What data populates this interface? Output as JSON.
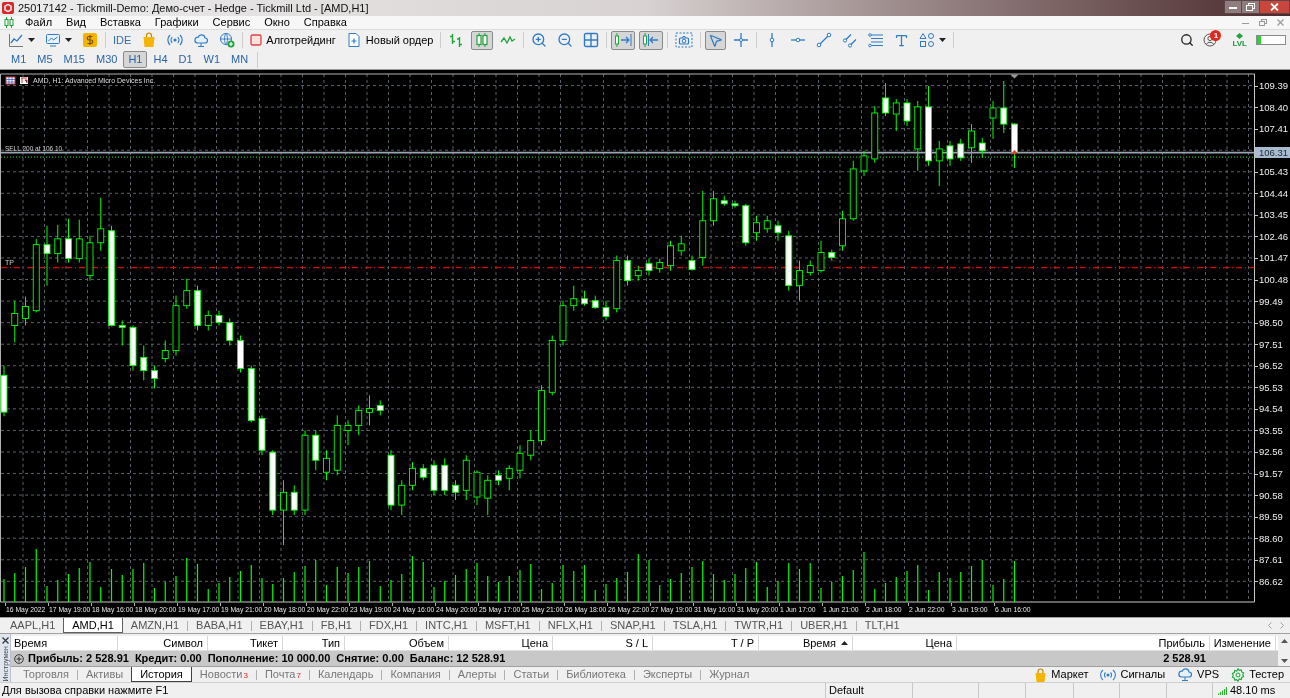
{
  "window": {
    "title": "25017142 - Tickmill-Demo: Демо-счет - Hedge - Tickmill Ltd - [AMD,H1]"
  },
  "menu": [
    "Файл",
    "Вид",
    "Вставка",
    "Графики",
    "Сервис",
    "Окно",
    "Справка"
  ],
  "toolbar": {
    "groups": [
      [
        {
          "selected": false
        },
        {
          "selected": false
        },
        {
          "selected": false
        }
      ],
      [
        {
          "label": "IDE",
          "selected": false
        },
        {
          "selected": false
        },
        {
          "selected": false
        },
        {
          "selected": false
        },
        {
          "selected": false
        }
      ],
      [
        {
          "label": "Алготрейдинг",
          "selected": false,
          "on": false
        },
        {
          "label": "Новый ордер",
          "selected": false
        }
      ],
      [
        {
          "selected": false
        },
        {
          "selected": true
        },
        {
          "selected": false
        }
      ],
      [
        {
          "selected": false
        },
        {
          "selected": false
        },
        {
          "selected": false
        }
      ],
      [
        {
          "selected": true
        },
        {
          "selected": true
        }
      ],
      [
        {
          "selected": false
        }
      ],
      [
        {
          "selected": true
        },
        {
          "selected": false
        }
      ],
      [
        {
          "selected": false
        },
        {
          "selected": false
        },
        {
          "selected": false
        },
        {
          "selected": false
        },
        {
          "selected": false
        },
        {
          "selected": false
        },
        {
          "selected": false
        }
      ]
    ]
  },
  "toolbar_right": {
    "notifications": "1",
    "level_label": "LVL",
    "progress": {
      "level": 0.15
    }
  },
  "timeframes": [
    {
      "label": "M1",
      "selected": false
    },
    {
      "label": "M5",
      "selected": false
    },
    {
      "label": "M15",
      "selected": false
    },
    {
      "label": "M30",
      "selected": false
    },
    {
      "label": "H1",
      "selected": true
    },
    {
      "label": "H4",
      "selected": false
    },
    {
      "label": "D1",
      "selected": false
    },
    {
      "label": "W1",
      "selected": false
    },
    {
      "label": "MN",
      "selected": false
    }
  ],
  "chart": {
    "title": "AMD, H1: Advanced Micro Devices Inc.",
    "chart_data": [
      {
        "type": "candlestick",
        "color": "#00ff00",
        "grid": true,
        "ylim": [
          85.67,
          109.92
        ],
        "yticks": [
          {
            "value": 86.62,
            "label": "86.62"
          },
          {
            "value": 87.61,
            "label": "87.61"
          },
          {
            "value": 88.6,
            "label": "88.60"
          },
          {
            "value": 89.59,
            "label": "89.59"
          },
          {
            "value": 90.58,
            "label": "90.58"
          },
          {
            "value": 91.57,
            "label": "91.57"
          },
          {
            "value": 92.56,
            "label": "92.56"
          },
          {
            "value": 93.55,
            "label": "93.55"
          },
          {
            "value": 94.54,
            "label": "94.54"
          },
          {
            "value": 95.53,
            "label": "95.53"
          },
          {
            "value": 96.52,
            "label": "96.52"
          },
          {
            "value": 97.51,
            "label": "97.51"
          },
          {
            "value": 98.5,
            "label": "98.50"
          },
          {
            "value": 99.49,
            "label": "99.49"
          },
          {
            "value": 100.48,
            "label": "100.48"
          },
          {
            "value": 101.47,
            "label": "101.47"
          },
          {
            "value": 102.46,
            "label": "102.46"
          },
          {
            "value": 103.45,
            "label": "103.45"
          },
          {
            "value": 104.44,
            "label": "104.44"
          },
          {
            "value": 105.43,
            "label": "105.43"
          },
          {
            "value": 107.41,
            "label": "107.41"
          },
          {
            "value": 108.4,
            "label": "108.40"
          },
          {
            "value": 109.39,
            "label": "109.39"
          }
        ],
        "categories": [
          null,
          null,
          "16 May 2022",
          null,
          null,
          null,
          "17 May 19:00",
          null,
          null,
          null,
          "18 May 16:00",
          null,
          null,
          null,
          "18 May 20:00",
          null,
          null,
          null,
          "19 May 17:00",
          null,
          null,
          null,
          "19 May 21:00",
          null,
          null,
          null,
          "20 May 18:00",
          null,
          null,
          null,
          "20 May 22:00",
          null,
          null,
          null,
          "23 May 19:00",
          null,
          null,
          null,
          "24 May 16:00",
          null,
          null,
          null,
          "24 May 20:00",
          null,
          null,
          null,
          "25 May 17:00",
          null,
          null,
          null,
          "25 May 21:00",
          null,
          null,
          null,
          "26 May 18:00",
          null,
          null,
          null,
          "26 May 22:00",
          null,
          null,
          null,
          "27 May 19:00",
          null,
          null,
          null,
          "31 May 16:00",
          null,
          null,
          null,
          "31 May 20:00",
          null,
          null,
          null,
          "1 Jun 17:00",
          null,
          null,
          null,
          "1 Jun 21:00",
          null,
          null,
          null,
          "2 Jun 18:00",
          null,
          null,
          null,
          "2 Jun 22:00",
          null,
          null,
          null,
          "3 Jun 19:00",
          null,
          null,
          null,
          "6 Jun 16:00",
          null,
          null,
          null,
          null,
          null,
          null,
          null,
          null,
          null,
          null,
          null,
          null,
          null,
          null,
          null,
          null,
          null,
          null,
          null,
          null,
          null,
          null
        ],
        "ohlc": [
          [
            96.08,
            96.53,
            94.2,
            94.39
          ],
          [
            98.37,
            99.51,
            97.59,
            98.92
          ],
          [
            98.69,
            99.7,
            98.37,
            99.24
          ],
          [
            99.05,
            102.35,
            98.97,
            102.08
          ],
          [
            102.08,
            102.95,
            100.2,
            101.67
          ],
          [
            101.67,
            102.99,
            101.26,
            102.35
          ],
          [
            102.35,
            103.27,
            101.26,
            101.44
          ],
          [
            101.44,
            103.23,
            101.26,
            102.35
          ],
          [
            100.66,
            102.49,
            100.43,
            102.17
          ],
          [
            102.17,
            104.24,
            101.8,
            102.81
          ],
          [
            102.72,
            102.95,
            98.33,
            98.37
          ],
          [
            98.37,
            98.6,
            97.45,
            98.28
          ],
          [
            98.28,
            98.37,
            96.3,
            96.53
          ],
          [
            96.9,
            97.45,
            95.85,
            96.3
          ],
          [
            96.3,
            96.53,
            95.48,
            95.94
          ],
          [
            96.85,
            97.68,
            96.67,
            97.22
          ],
          [
            97.22,
            99.74,
            96.99,
            99.28
          ],
          [
            99.28,
            100.52,
            99.14,
            99.97
          ],
          [
            99.97,
            100.2,
            98.14,
            98.37
          ],
          [
            98.37,
            99.05,
            98.14,
            98.83
          ],
          [
            98.83,
            99.05,
            98.37,
            98.51
          ],
          [
            98.51,
            98.69,
            97.45,
            97.68
          ],
          [
            97.68,
            97.91,
            96.21,
            96.39
          ],
          [
            96.39,
            96.53,
            93.92,
            94.01
          ],
          [
            94.1,
            94.24,
            92.41,
            92.64
          ],
          [
            92.55,
            92.64,
            89.66,
            89.89
          ],
          [
            89.89,
            91.26,
            88.28,
            90.71
          ],
          [
            90.71,
            91.03,
            89.66,
            89.89
          ],
          [
            89.89,
            93.55,
            89.66,
            93.33
          ],
          [
            93.33,
            93.55,
            91.72,
            92.18
          ],
          [
            91.63,
            92.64,
            91.26,
            92.27
          ],
          [
            91.72,
            94.24,
            91.49,
            93.78
          ],
          [
            93.55,
            94.01,
            92.87,
            93.78
          ],
          [
            93.78,
            94.7,
            93.33,
            94.47
          ],
          [
            94.38,
            95.16,
            93.78,
            94.56
          ],
          [
            94.7,
            94.93,
            94.24,
            94.47
          ],
          [
            92.41,
            92.64,
            89.89,
            90.12
          ],
          [
            90.12,
            91.26,
            89.66,
            91.03
          ],
          [
            91.03,
            92.09,
            90.8,
            91.81
          ],
          [
            91.81,
            92.0,
            91.26,
            91.4
          ],
          [
            91.95,
            92.18,
            90.58,
            90.8
          ],
          [
            91.95,
            92.27,
            90.58,
            90.8
          ],
          [
            91.03,
            91.26,
            90.35,
            90.71
          ],
          [
            90.8,
            92.41,
            90.35,
            92.18
          ],
          [
            90.49,
            91.72,
            90.12,
            91.63
          ],
          [
            90.44,
            91.49,
            89.66,
            91.26
          ],
          [
            91.49,
            91.72,
            91.03,
            91.26
          ],
          [
            91.35,
            91.95,
            90.8,
            91.81
          ],
          [
            91.72,
            92.87,
            91.35,
            92.5
          ],
          [
            92.41,
            93.55,
            92.18,
            93.09
          ],
          [
            93.09,
            95.62,
            92.87,
            95.39
          ],
          [
            95.3,
            97.91,
            95.16,
            97.68
          ],
          [
            97.68,
            99.51,
            97.45,
            99.28
          ],
          [
            99.28,
            100.2,
            99.05,
            99.6
          ],
          [
            99.6,
            99.97,
            99.28,
            99.37
          ],
          [
            99.51,
            99.74,
            99.14,
            99.19
          ],
          [
            99.19,
            99.51,
            98.6,
            98.78
          ],
          [
            99.14,
            101.58,
            98.97,
            101.35
          ],
          [
            101.35,
            101.58,
            100.2,
            100.43
          ],
          [
            100.66,
            101.12,
            100.43,
            100.89
          ],
          [
            101.21,
            101.44,
            100.66,
            100.89
          ],
          [
            100.98,
            101.44,
            100.8,
            101.26
          ],
          [
            101.12,
            102.26,
            100.89,
            102.03
          ],
          [
            101.8,
            102.49,
            101.58,
            102.12
          ],
          [
            101.35,
            101.58,
            100.89,
            100.94
          ],
          [
            101.49,
            104.55,
            101.12,
            103.18
          ],
          [
            103.18,
            104.55,
            102.95,
            104.19
          ],
          [
            104.1,
            104.33,
            103.87,
            103.96
          ],
          [
            103.96,
            104.1,
            103.78,
            103.87
          ],
          [
            103.87,
            103.96,
            102.03,
            102.17
          ],
          [
            102.63,
            103.41,
            102.26,
            103.09
          ],
          [
            102.81,
            103.41,
            102.63,
            103.18
          ],
          [
            102.95,
            103.18,
            102.26,
            102.63
          ],
          [
            102.49,
            102.72,
            99.97,
            100.2
          ],
          [
            100.2,
            101.35,
            99.51,
            100.89
          ],
          [
            100.8,
            101.35,
            100.66,
            101.12
          ],
          [
            100.89,
            102.26,
            100.8,
            101.72
          ],
          [
            101.72,
            101.85,
            101.35,
            101.49
          ],
          [
            102.03,
            103.64,
            101.8,
            103.27
          ],
          [
            103.27,
            105.93,
            103.18,
            105.56
          ],
          [
            105.47,
            106.39,
            105.24,
            106.16
          ],
          [
            106.02,
            108.45,
            105.84,
            108.13
          ],
          [
            108.82,
            109.5,
            107.99,
            108.13
          ],
          [
            108.08,
            108.77,
            107.3,
            108.59
          ],
          [
            108.59,
            108.77,
            107.53,
            107.76
          ],
          [
            106.48,
            108.68,
            105.47,
            108.41
          ],
          [
            108.41,
            109.37,
            105.7,
            105.93
          ],
          [
            105.93,
            106.85,
            104.78,
            106.48
          ],
          [
            106.62,
            106.85,
            105.7,
            106.02
          ],
          [
            106.71,
            106.94,
            105.93,
            106.07
          ],
          [
            106.53,
            107.62,
            105.84,
            107.3
          ],
          [
            106.75,
            106.99,
            106.07,
            106.39
          ],
          [
            107.9,
            108.68,
            106.94,
            108.36
          ],
          [
            108.36,
            109.6,
            107.21,
            107.62
          ],
          [
            107.62,
            107.67,
            105.61,
            106.31
          ],
          null,
          null,
          null,
          null,
          null,
          null,
          null,
          null,
          null,
          null,
          null,
          null,
          null,
          null,
          null,
          null,
          null,
          null,
          null,
          null,
          null,
          null
        ],
        "ref_lines": [
          {
            "axis": "y",
            "value": 106.31,
            "label": "106.31",
            "color": "#9aa5b1",
            "line_style": "solid"
          },
          {
            "axis": "y",
            "value": 106.1,
            "label": "SELL 200 at 106.10",
            "color": "#00c800",
            "line_style": "dotted"
          },
          {
            "axis": "y",
            "value": 101.03,
            "label": "TP",
            "color": "#e00000",
            "line_style": "dashdot"
          }
        ]
      }
    ]
  },
  "chart_tabs": [
    {
      "label": "AAPL,H1",
      "selected": false
    },
    {
      "label": "AMD,H1",
      "selected": true
    },
    {
      "label": "AMZN,H1",
      "selected": false
    },
    {
      "label": "BABA,H1",
      "selected": false
    },
    {
      "label": "EBAY,H1",
      "selected": false
    },
    {
      "label": "FB,H1",
      "selected": false
    },
    {
      "label": "FDX,H1",
      "selected": false
    },
    {
      "label": "INTC,H1",
      "selected": false
    },
    {
      "label": "MSFT,H1",
      "selected": false
    },
    {
      "label": "NFLX,H1",
      "selected": false
    },
    {
      "label": "SNAP,H1",
      "selected": false
    },
    {
      "label": "TSLA,H1",
      "selected": false
    },
    {
      "label": "TWTR,H1",
      "selected": false
    },
    {
      "label": "UBER,H1",
      "selected": false
    },
    {
      "label": "TLT,H1",
      "selected": false
    }
  ],
  "toolbox": {
    "side_label": "Инструмен",
    "columns": [
      {
        "label": "Время",
        "sorted": false
      },
      {
        "label": "Символ",
        "sorted": false
      },
      {
        "label": "Тикет",
        "sorted": false
      },
      {
        "label": "Тип",
        "sorted": false
      },
      {
        "label": "Объем",
        "sorted": false
      },
      {
        "label": "Цена",
        "sorted": false
      },
      {
        "label": "S / L",
        "sorted": false
      },
      {
        "label": "T / P",
        "sorted": false
      },
      {
        "label": "Время",
        "sorted": true
      },
      {
        "label": "Цена",
        "sorted": false
      },
      {
        "label": "Прибыль",
        "sorted": false
      },
      {
        "label": "Изменение",
        "sorted": false
      }
    ],
    "summary": [
      "Прибыль: 2 528.91",
      "Кредит: 0.00",
      "Пополнение: 10 000.00",
      "Снятие: 0.00",
      "Баланс: 12 528.91"
    ],
    "total_profit": "2 528.91",
    "tabs": [
      {
        "label": "Торговля",
        "selected": false
      },
      {
        "label": "Активы",
        "selected": false
      },
      {
        "label": "История",
        "selected": true
      },
      {
        "label": "Новости",
        "badge": "3",
        "selected": false
      },
      {
        "label": "Почта",
        "badge": "7",
        "selected": false
      },
      {
        "label": "Календарь",
        "selected": false
      },
      {
        "label": "Компания",
        "selected": false
      },
      {
        "label": "Алерты",
        "selected": false
      },
      {
        "label": "Статьи",
        "selected": false
      },
      {
        "label": "Библиотека",
        "selected": false
      },
      {
        "label": "Эксперты",
        "selected": false
      },
      {
        "label": "Журнал",
        "selected": false
      }
    ],
    "services": [
      "Маркет",
      "Сигналы",
      "VPS",
      "Тестер"
    ]
  },
  "status": {
    "hint": "Для вызова справки нажмите F1",
    "profile": "Default",
    "ping": "48.10 ms"
  }
}
